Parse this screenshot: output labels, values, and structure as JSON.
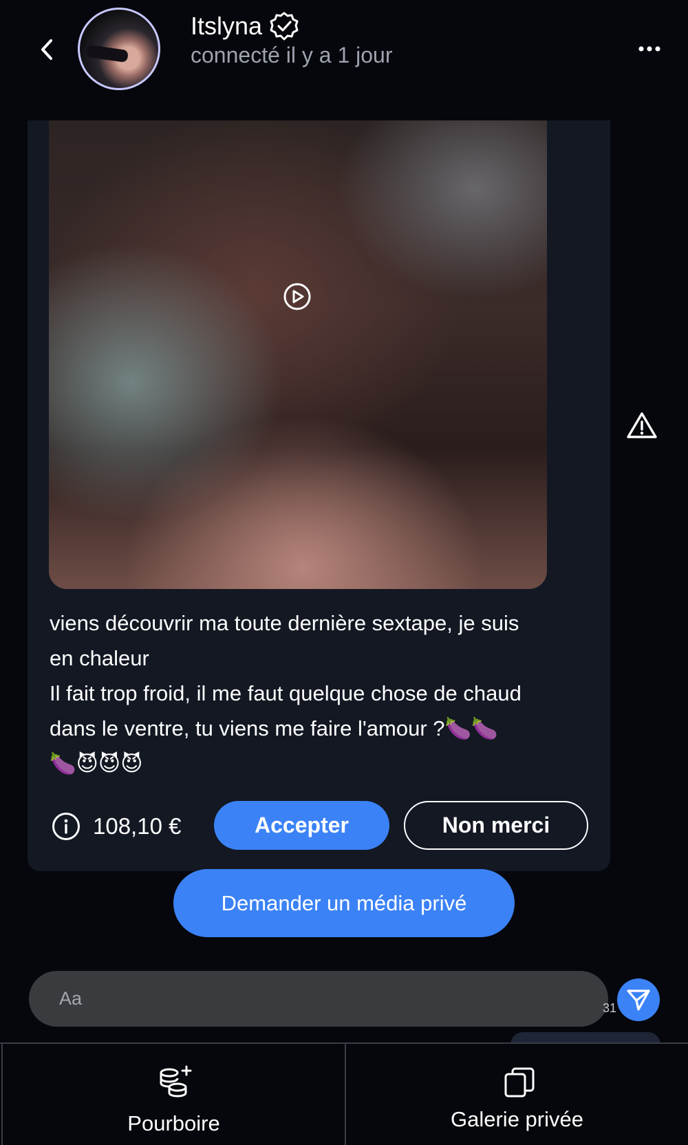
{
  "header": {
    "name": "Itslyna",
    "status": "connecté il y a 1 jour"
  },
  "message": {
    "text": "viens découvrir ma toute dernière sextape, je suis\nen chaleur\nIl fait trop froid, il me faut quelque chose de chaud\ndans le ventre, tu viens me faire l'amour ?🍆🍆\n🍆😈😈😈",
    "price": "108,10 €",
    "accept_label": "Accepter",
    "decline_label": "Non merci"
  },
  "request_label": "Demander un média privé",
  "composer": {
    "placeholder": "Aa",
    "time_stub": "31"
  },
  "bottom_tabs": {
    "tip_label": "Pourboire",
    "gallery_label": "Galerie privée"
  },
  "colors": {
    "accent": "#3b82f6",
    "background": "#05070c",
    "card": "#131823"
  },
  "icons": [
    "back-chevron-icon",
    "verified-badge-icon",
    "more-dots-icon",
    "play-icon",
    "warning-icon",
    "info-icon",
    "send-icon",
    "coins-plus-icon",
    "gallery-copy-icon"
  ]
}
